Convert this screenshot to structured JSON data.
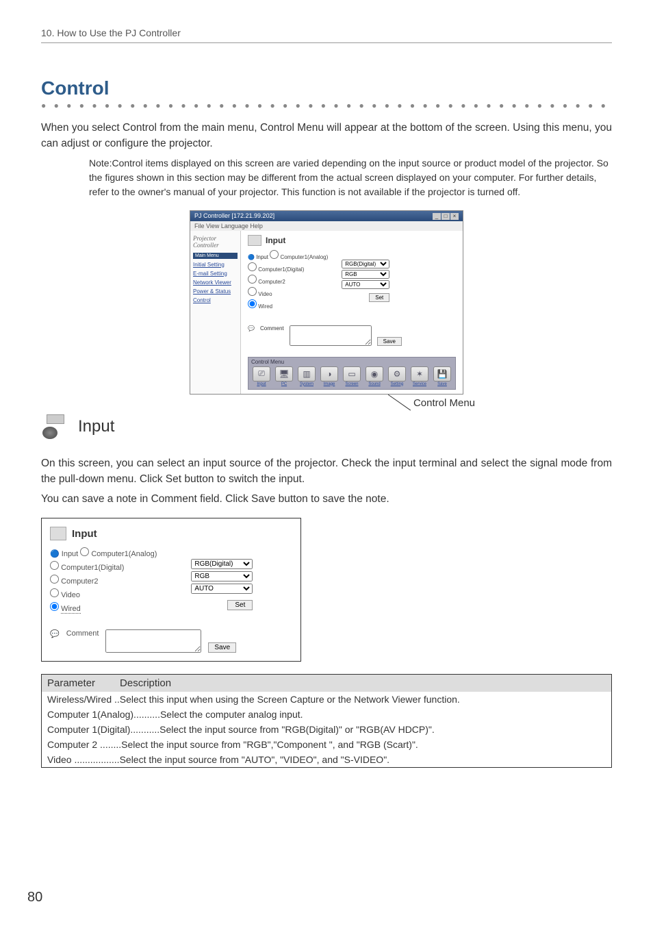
{
  "chapter": "10. How to Use the PJ Controller",
  "heading_main": "Control",
  "intro_para": "When you select Control from the main menu, Control Menu will appear at the bottom of the screen. Using this menu, you can adjust or configure the projector.",
  "note_para": "Note:Control items displayed on this screen are varied depending on the input source or product model of the projector.  So the figures shown in this section may be different from the actual screen displayed on your computer.  For further details, refer to the owner's manual of your projector. This function is not available if the projector is turned off.",
  "app_window": {
    "title": "PJ Controller [172.21.99.202]",
    "menus": "File  View  Language  Help",
    "sidebar_logo": "Projector Controller",
    "main_menu_label": "Main Menu",
    "sidebar_items": [
      "Initial Setting",
      "E-mail Setting",
      "Network Viewer",
      "Power & Status",
      "Control"
    ],
    "panel_title": "Input",
    "input_label": "Input",
    "radios": [
      "Computer1(Analog)",
      "Computer1(Digital)",
      "Computer2",
      "Video",
      "Wired"
    ],
    "selects": [
      "RGB(Digital)",
      "RGB",
      "AUTO"
    ],
    "set_button": "Set",
    "comment_label": "Comment",
    "save_button": "Save",
    "control_menu_title": "Control Menu",
    "cm_items": [
      {
        "icon": "⎚",
        "label": "Input"
      },
      {
        "icon": "🖥",
        "label": "PC"
      },
      {
        "icon": "▥",
        "label": "System"
      },
      {
        "icon": "◑",
        "label": "Image"
      },
      {
        "icon": "▭",
        "label": "Screen"
      },
      {
        "icon": "◉",
        "label": "Sound"
      },
      {
        "icon": "⚙",
        "label": "Setting"
      },
      {
        "icon": "✶",
        "label": "Service"
      },
      {
        "icon": "💾",
        "label": "Save"
      }
    ]
  },
  "control_menu_callout": "Control Menu",
  "input_section_heading": "Input",
  "input_desc_1": "On this screen, you can select an input source of the projector.  Check the input terminal and select the signal mode from the pull-down menu.  Click Set button to switch the input.",
  "input_desc_2": "You can save a note in Comment field. Click Save button to save the note.",
  "input_panel": {
    "title": "Input",
    "input_label": "Input",
    "radios": [
      "Computer1(Analog)",
      "Computer1(Digital)",
      "Computer2",
      "Video",
      "Wired"
    ],
    "selects": [
      "RGB(Digital)",
      "RGB",
      "AUTO"
    ],
    "set_button": "Set",
    "comment_label": "Comment",
    "save_button": "Save"
  },
  "param_header_1": "Parameter",
  "param_header_2": "Description",
  "param_rows": [
    "Wireless/Wired ..Select this input when using the Screen Capture or the Network Viewer function.",
    "Computer 1(Analog)..........Select the computer analog input.",
    "Computer 1(Digital)...........Select the input source from \"RGB(Digital)\" or \"RGB(AV HDCP)\".",
    "Computer 2 ........Select the input source from \"RGB\",\"Component \",  and \"RGB (Scart)\".",
    "Video .................Select the input source from \"AUTO\", \"VIDEO\", and \"S-VIDEO\"."
  ],
  "page_number": "80"
}
